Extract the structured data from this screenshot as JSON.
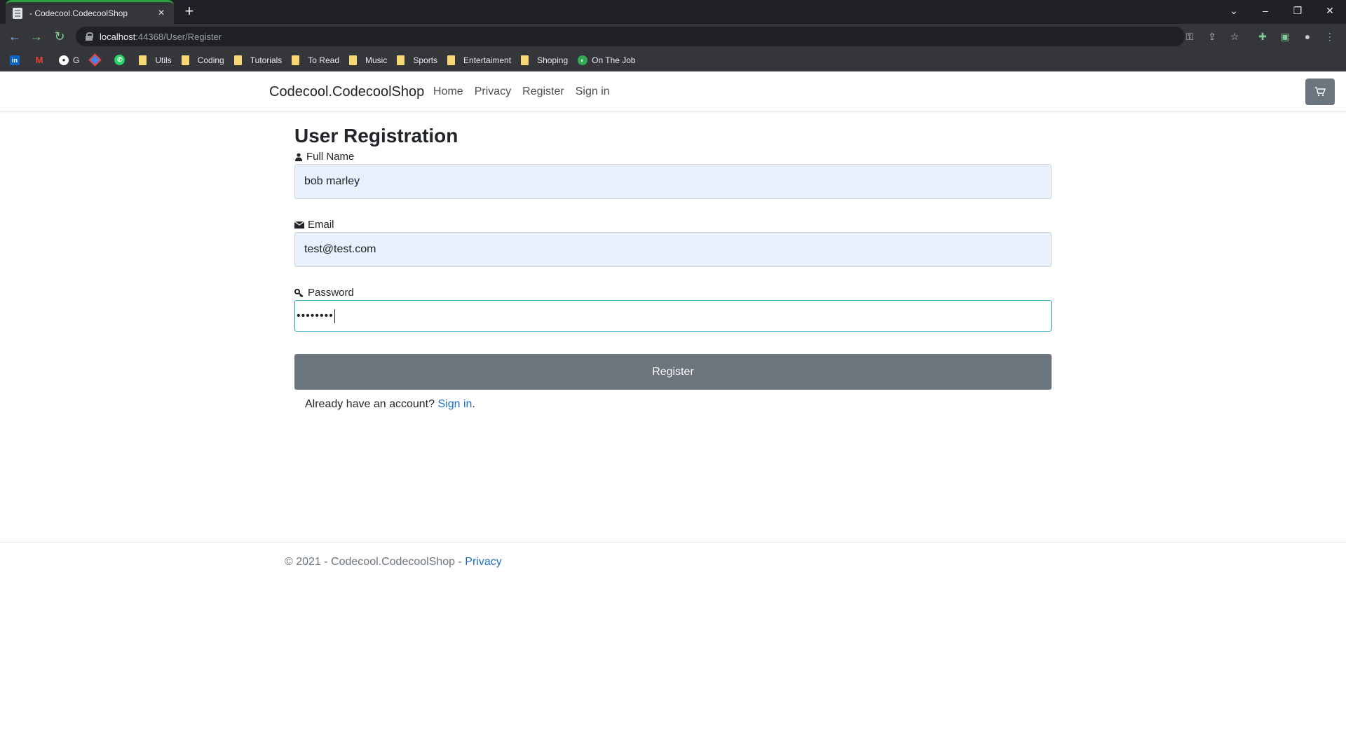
{
  "browser": {
    "tab_title": "- Codecool.CodecoolShop",
    "url_host": "localhost",
    "url_path": ":44368/User/Register",
    "bookmarks": [
      {
        "label": "",
        "icon": "linkedin-icon"
      },
      {
        "label": "",
        "icon": "gmail-icon"
      },
      {
        "label": "G",
        "icon": "github-icon"
      },
      {
        "label": "",
        "icon": "diamond-app-icon"
      },
      {
        "label": "",
        "icon": "whatsapp-icon"
      },
      {
        "label": "Utils",
        "icon": "folder-icon"
      },
      {
        "label": "Coding",
        "icon": "folder-icon"
      },
      {
        "label": "Tutorials",
        "icon": "folder-icon"
      },
      {
        "label": "To Read",
        "icon": "folder-icon"
      },
      {
        "label": "Music",
        "icon": "folder-icon"
      },
      {
        "label": "Sports",
        "icon": "folder-icon"
      },
      {
        "label": "Entertaiment",
        "icon": "folder-icon"
      },
      {
        "label": "Shoping",
        "icon": "folder-icon"
      },
      {
        "label": "On The Job",
        "icon": "globe-icon"
      }
    ]
  },
  "navbar": {
    "brand": "Codecool.CodecoolShop",
    "links": [
      "Home",
      "Privacy",
      "Register",
      "Sign in"
    ],
    "cart_icon": "cart-icon"
  },
  "form": {
    "title": "User Registration",
    "full_name_label": "Full Name",
    "full_name_value": "bob marley",
    "email_label": "Email",
    "email_value": "test@test.com",
    "password_label": "Password",
    "password_value": "••••••••",
    "submit_label": "Register",
    "already_text": "Already have an account?",
    "signin_link": "Sign in",
    "signin_period": "."
  },
  "footer": {
    "text": "© 2021 - Codecool.CodecoolShop - ",
    "privacy_link": "Privacy"
  },
  "colors": {
    "accent_link": "#1e6fc7",
    "button_gray": "#6c757d",
    "autofill_bg": "#e8f0fe",
    "focus_border": "#17a2b8"
  }
}
